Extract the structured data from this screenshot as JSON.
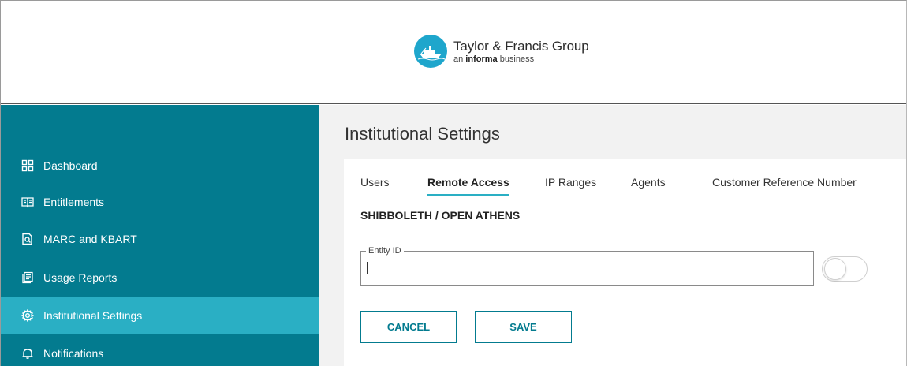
{
  "header": {
    "logo_title": "Taylor & Francis Group",
    "logo_sub_prefix": "an ",
    "logo_sub_bold": "informa",
    "logo_sub_suffix": " business"
  },
  "colors": {
    "sidebar_bg": "#037b8f",
    "sidebar_active": "#2aafc4",
    "logo_teal": "#1ea6cc",
    "accent": "#037b8f"
  },
  "sidebar": {
    "items": [
      {
        "label": "Dashboard",
        "icon": "dashboard-grid-icon",
        "active": false
      },
      {
        "label": "Entitlements",
        "icon": "book-icon",
        "active": false
      },
      {
        "label": "MARC and KBART",
        "icon": "file-search-icon",
        "active": false
      },
      {
        "label": "Usage Reports",
        "icon": "report-icon",
        "active": false
      },
      {
        "label": "Institutional Settings",
        "icon": "gear-icon",
        "active": true
      },
      {
        "label": "Notifications",
        "icon": "bell-icon",
        "active": false
      }
    ]
  },
  "main": {
    "title": "Institutional Settings",
    "tabs": [
      {
        "label": "Users",
        "active": false
      },
      {
        "label": "Remote Access",
        "active": true
      },
      {
        "label": "IP Ranges",
        "active": false
      },
      {
        "label": "Agents",
        "active": false
      },
      {
        "label": "Customer Reference Number",
        "active": false
      }
    ],
    "section_heading": "SHIBBOLETH / OPEN ATHENS",
    "entity_field": {
      "label": "Entity ID",
      "value": ""
    },
    "toggle_on": false,
    "buttons": {
      "cancel": "CANCEL",
      "save": "SAVE"
    }
  }
}
